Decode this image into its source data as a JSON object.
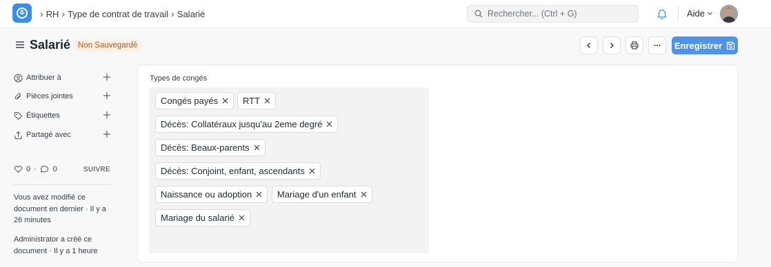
{
  "navbar": {
    "breadcrumb": [
      "RH",
      "Type de contrat de travail",
      "Salarié"
    ],
    "search_placeholder": "Rechercher... (Ctrl + G)",
    "help_label": "Aide"
  },
  "header": {
    "title": "Salarié",
    "status": "Non Sauvegardé",
    "save_label": "Enregistrer"
  },
  "sidebar": {
    "items": [
      {
        "label": "Attribuer à",
        "icon": "assign-user-icon"
      },
      {
        "label": "Pièces jointes",
        "icon": "paperclip-icon"
      },
      {
        "label": "Étiquettes",
        "icon": "tag-icon"
      },
      {
        "label": "Partagé avec",
        "icon": "share-icon"
      }
    ],
    "likes": "0",
    "comments": "0",
    "follow_label": "SUIVRE",
    "activity": [
      "Vous avez modifié ce document en dernier · Il y a 26 minutes",
      "Administrator a créé ce document · Il y a 1 heure"
    ]
  },
  "form": {
    "field_label": "Types de congés",
    "tags": [
      "Congés payés",
      "RTT",
      "Décès: Collatéraux jusqu'au 2eme degré",
      "Décès: Beaux-parents",
      "Décès: Conjoint, enfant, ascendants",
      "Naissance ou adoption",
      "Mariage d'un enfant",
      "Mariage du salarié"
    ]
  },
  "colors": {
    "accent": "#4c95ea",
    "badge_bg": "#fff0e6",
    "badge_text": "#b8541d"
  }
}
